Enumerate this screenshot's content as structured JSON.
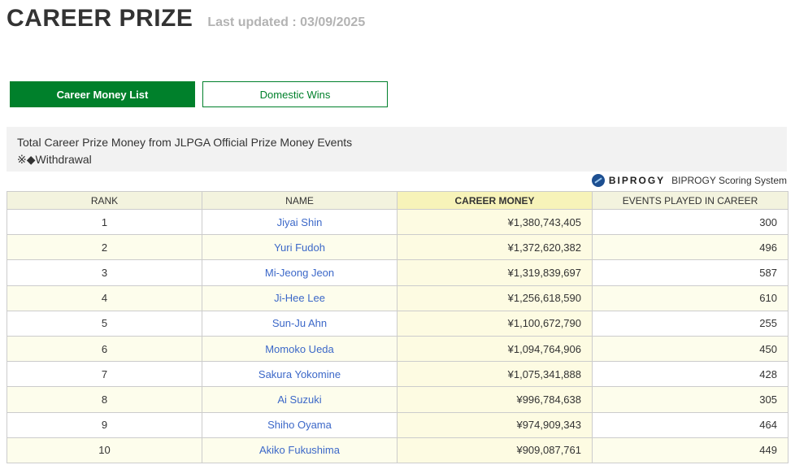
{
  "header": {
    "title": "CAREER PRIZE",
    "last_updated": "Last updated : 03/09/2025"
  },
  "tabs": [
    {
      "label": "Career Money List",
      "active": true
    },
    {
      "label": "Domestic Wins",
      "active": false
    }
  ],
  "info": {
    "description": "Total Career Prize Money from JLPGA Official Prize Money Events",
    "note": "※◆Withdrawal"
  },
  "sponsor": {
    "logo_icon": "biprogy-logo-icon",
    "brand": "BIPROGY",
    "text": "BIPROGY Scoring System"
  },
  "colors": {
    "accent_green": "#00802b",
    "link_blue": "#3c68c8",
    "header_bg": "#f3f3de",
    "money_header_bg": "#f7f3b9"
  },
  "table": {
    "columns": [
      "RANK",
      "NAME",
      "CAREER MONEY",
      "EVENTS PLAYED IN CAREER"
    ],
    "rows": [
      {
        "rank": "1",
        "name": "Jiyai Shin",
        "money": "¥1,380,743,405",
        "events": "300"
      },
      {
        "rank": "2",
        "name": "Yuri Fudoh",
        "money": "¥1,372,620,382",
        "events": "496"
      },
      {
        "rank": "3",
        "name": "Mi-Jeong Jeon",
        "money": "¥1,319,839,697",
        "events": "587"
      },
      {
        "rank": "4",
        "name": "Ji-Hee Lee",
        "money": "¥1,256,618,590",
        "events": "610"
      },
      {
        "rank": "5",
        "name": "Sun-Ju Ahn",
        "money": "¥1,100,672,790",
        "events": "255"
      },
      {
        "rank": "6",
        "name": "Momoko Ueda",
        "money": "¥1,094,764,906",
        "events": "450"
      },
      {
        "rank": "7",
        "name": "Sakura Yokomine",
        "money": "¥1,075,341,888",
        "events": "428"
      },
      {
        "rank": "8",
        "name": "Ai Suzuki",
        "money": "¥996,784,638",
        "events": "305"
      },
      {
        "rank": "9",
        "name": "Shiho Oyama",
        "money": "¥974,909,343",
        "events": "464"
      },
      {
        "rank": "10",
        "name": "Akiko Fukushima",
        "money": "¥909,087,761",
        "events": "449"
      }
    ]
  }
}
